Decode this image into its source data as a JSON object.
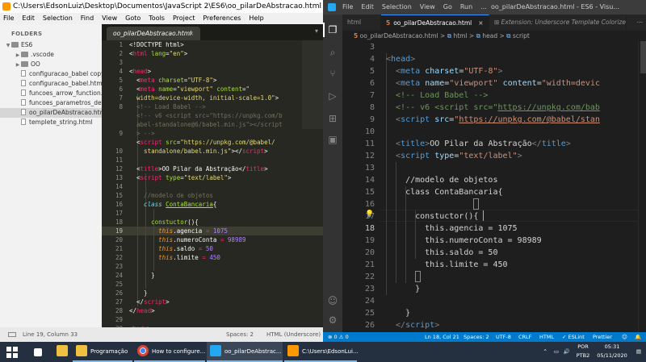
{
  "sublime": {
    "title": "C:\\Users\\EdsonLuiz\\Desktop\\Documentos\\JavaScript 2\\ES6\\oo_pilarDeAbstracao.html (ES6) - Sublime Text (UNREGISTERED)",
    "menu": [
      "File",
      "Edit",
      "Selection",
      "Find",
      "View",
      "Goto",
      "Tools",
      "Project",
      "Preferences",
      "Help"
    ],
    "sidebar": {
      "header": "FOLDERS",
      "items": [
        {
          "label": "ES6",
          "type": "folder-open"
        },
        {
          "label": ".vscode",
          "type": "folder"
        },
        {
          "label": "OO",
          "type": "folder"
        },
        {
          "label": "configuracao_babel copy.html",
          "type": "file"
        },
        {
          "label": "configuracao_babel.html",
          "type": "file"
        },
        {
          "label": "funcoes_arrow_function.html",
          "type": "file"
        },
        {
          "label": "funcoes_parametros_default.html",
          "type": "file"
        },
        {
          "label": "oo_pilarDeAbstracao.html",
          "type": "file"
        },
        {
          "label": "templete_string.html",
          "type": "file"
        }
      ]
    },
    "tab": {
      "label": "oo_pilarDeAbstracao.html",
      "close": "×"
    },
    "tab_arrow": "▾",
    "line_numbers": [
      "1",
      "2",
      "3",
      "4",
      "5",
      "6",
      "7",
      "8",
      "",
      "",
      "9",
      "",
      "10",
      "11",
      "12",
      "13",
      "14",
      "15",
      "16",
      "17",
      "18",
      "19",
      "20",
      "21",
      "22",
      "23",
      "24",
      "25",
      "26",
      "27",
      "28",
      "29",
      "30"
    ],
    "current_line": "19",
    "status": {
      "position": "Line 19, Column 33",
      "spaces": "Spaces: 2",
      "syntax": "HTML (Underscore)"
    }
  },
  "vscode": {
    "menu": [
      "File",
      "Edit",
      "Selection",
      "View",
      "Go",
      "Run",
      "..."
    ],
    "window_title": "oo_pilarDeAbstracao.html - ES6 - Visu...",
    "tabs": [
      {
        "label": "html",
        "kind": "partial"
      },
      {
        "label": "oo_pilarDeAbstracao.html",
        "kind": "active",
        "icon": "5",
        "close": "×"
      },
      {
        "label": "Extension: Underscore Template Colorizer",
        "kind": "extension"
      }
    ],
    "breadcrumbs": {
      "file": "oo_pilarDeAbstracao.html",
      "html": "html",
      "head": "head",
      "script": "script",
      "sep": ">",
      "icon": "5",
      "tagicon": "⧉"
    },
    "line_numbers": [
      "3",
      "4",
      "5",
      "6",
      "7",
      "8",
      "9",
      "10",
      "11",
      "12",
      "13",
      "14",
      "15",
      "16",
      "17",
      "18",
      "19",
      "20",
      "21",
      "22",
      "23",
      "24",
      "25",
      "26",
      "27"
    ],
    "current_line": "18",
    "status": {
      "errors": "⊗ 0 ⚠ 0",
      "position": "Ln 18, Col 21",
      "spaces": "Spaces: 2",
      "encoding": "UTF-8",
      "eol": "CRLF",
      "language": "HTML",
      "eslint": "✓ ESLint",
      "prettier": "Prettier"
    }
  },
  "taskbar": {
    "items": [
      {
        "label": "Programação"
      },
      {
        "label": "How to configure..."
      },
      {
        "label": "oo_pilarDeAbstrac..."
      },
      {
        "label": "C:\\Users\\EdsonLui..."
      }
    ],
    "tray": {
      "lang": "POR",
      "layout": "PTB2",
      "time": "05:31",
      "date": "05/11/2020"
    }
  },
  "colors": {
    "sublime_bg": "#272822",
    "vscode_bg": "#1e1e1e",
    "vscode_status": "#007acc",
    "taskbar": "#24303f"
  }
}
